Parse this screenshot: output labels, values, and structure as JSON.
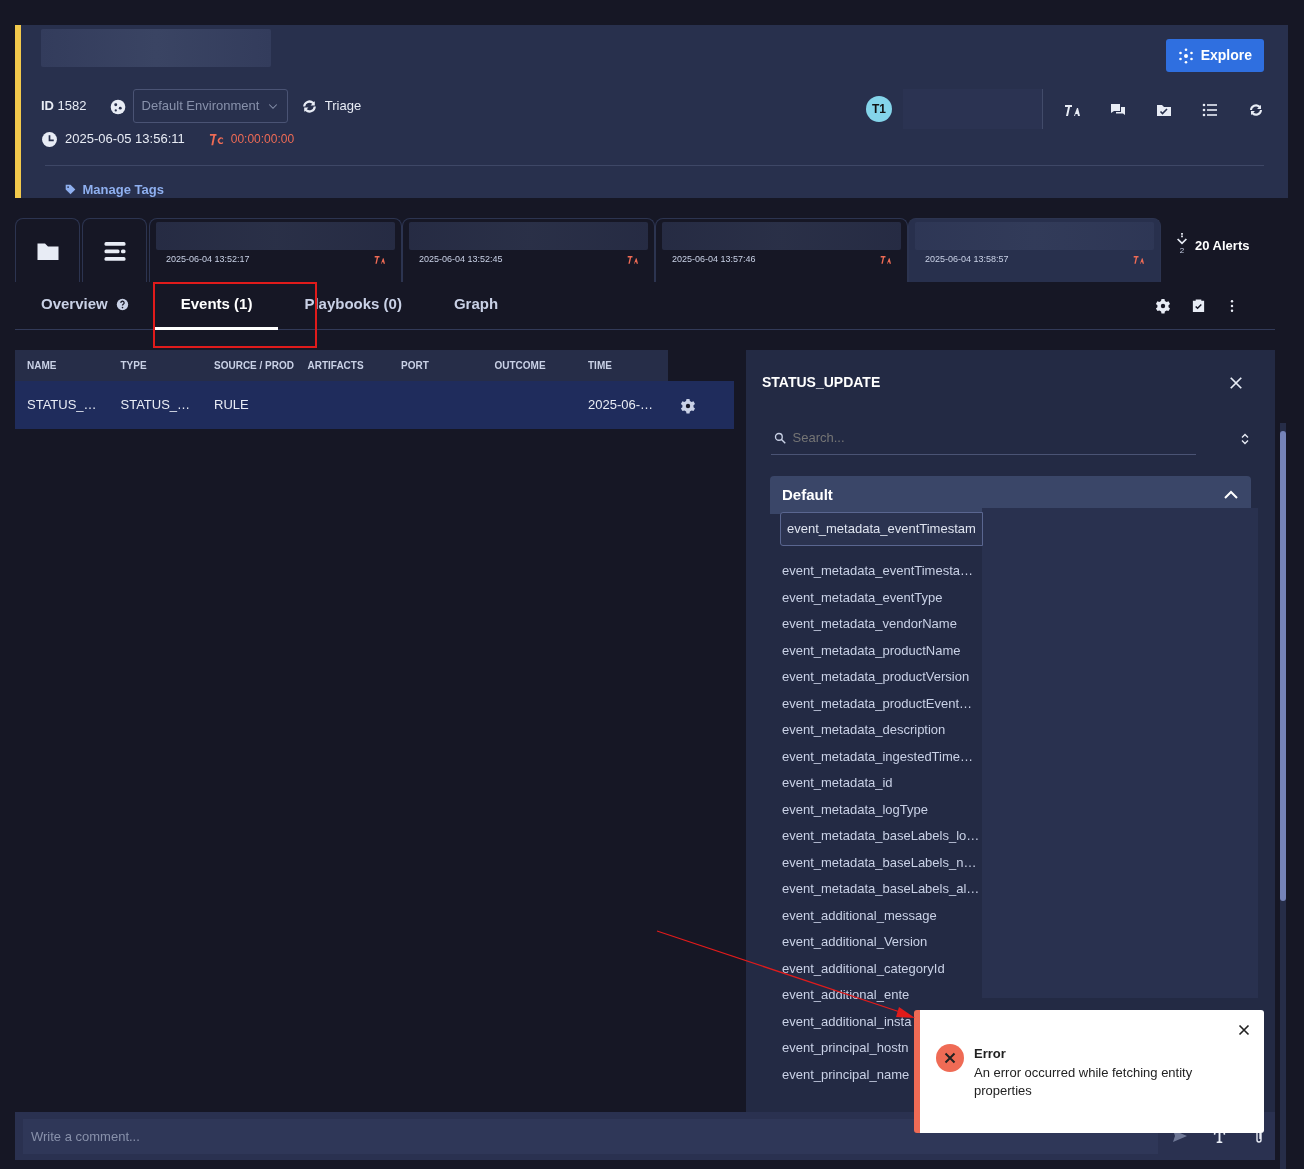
{
  "header": {
    "id_text": "**ID** 1582",
    "environment": "Default Environment",
    "triage": "Triage",
    "avatar": "T1",
    "explore": "Explore",
    "created": "2025-06-05 13:56:11",
    "timer": "00:00:00:00",
    "manage_tags": "Manage Tags"
  },
  "alerts": [
    {
      "time": "2025-06-04 13:52:17",
      "selected": false
    },
    {
      "time": "2025-06-04 13:52:45",
      "selected": false
    },
    {
      "time": "2025-06-04 13:57:46",
      "selected": false
    },
    {
      "time": "2025-06-04 13:58:57",
      "selected": true
    }
  ],
  "alerts_count": "20 Alerts",
  "alerts_count_sub": "2",
  "tabs": [
    {
      "label": "Overview",
      "help": true,
      "selected": false
    },
    {
      "label": "Events (1)",
      "help": false,
      "selected": true
    },
    {
      "label": "Playbooks (0)",
      "help": false,
      "selected": false
    },
    {
      "label": "Graph",
      "help": false,
      "selected": false
    }
  ],
  "table": {
    "columns": [
      "NAME",
      "TYPE",
      "SOURCE / PROD",
      "ARTIFACTS",
      "PORT",
      "OUTCOME",
      "TIME"
    ],
    "rows": [
      {
        "cells": [
          "STATUS_…",
          "STATUS_…",
          "RULE",
          "",
          "",
          "",
          "2025-06-…"
        ],
        "selected": true
      }
    ]
  },
  "detail": {
    "title": "STATUS_UPDATE",
    "search_placeholder": "Search...",
    "section": {
      "title": "Default",
      "expanded": true
    },
    "tooltip": "event_metadata_eventTimestam",
    "fields": [
      "event_metadata_eventTimesta…",
      "event_metadata_eventType",
      "event_metadata_vendorName",
      "event_metadata_productName",
      "event_metadata_productVersion",
      "event_metadata_productEvent…",
      "event_metadata_description",
      "event_metadata_ingestedTime…",
      "event_metadata_id",
      "event_metadata_logType",
      "event_metadata_baseLabels_lo…",
      "event_metadata_baseLabels_n…",
      "event_metadata_baseLabels_al…",
      "event_additional_message",
      "event_additional_Version",
      "event_additional_categoryId",
      "event_additional_ente",
      "event_additional_insta",
      "event_principal_hostn",
      "event_principal_name"
    ]
  },
  "toast": {
    "title": "Error",
    "message": "An error occurred while fetching entity properties"
  },
  "comment": {
    "placeholder": "Write a comment..."
  }
}
